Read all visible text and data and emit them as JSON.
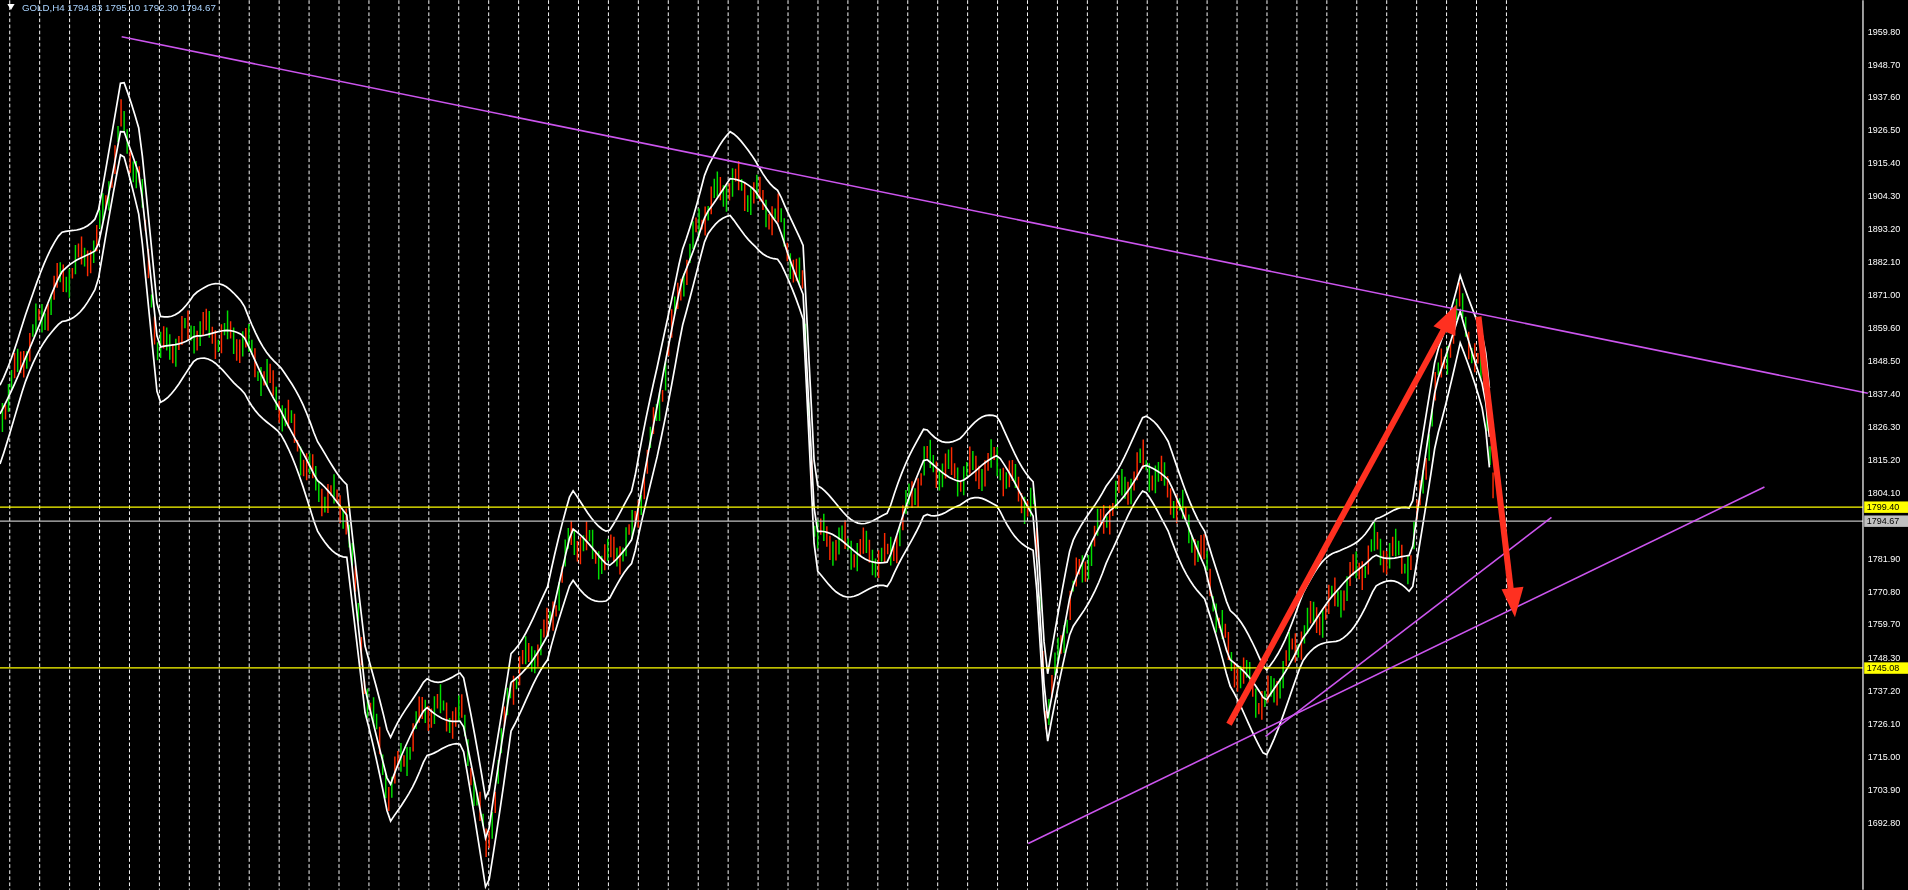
{
  "chart": {
    "header": "GOLD,H4 1794.83 1795.10 1792.30 1794.67",
    "y_ticks": [
      "1959.80",
      "1948.70",
      "1937.60",
      "1926.50",
      "1915.40",
      "1904.30",
      "1893.20",
      "1882.10",
      "1871.00",
      "1859.60",
      "1848.50",
      "1837.40",
      "1826.30",
      "1815.20",
      "1804.10",
      "1781.90",
      "1770.80",
      "1759.70",
      "1748.30",
      "1737.20",
      "1726.10",
      "1715.00",
      "1703.90",
      "1692.80"
    ],
    "price_lines": [
      {
        "label": "1799.40",
        "color": "#ffff00"
      },
      {
        "label": "1794.67",
        "color": "#c0c0c0"
      },
      {
        "label": "1745.08",
        "color": "#ffff00"
      }
    ]
  }
}
